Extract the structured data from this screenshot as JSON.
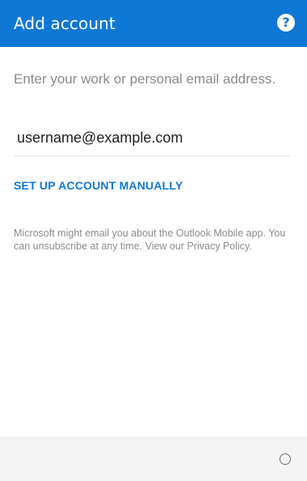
{
  "header": {
    "title": "Add account",
    "help_glyph": "?",
    "help_icon": "help-question-icon"
  },
  "form": {
    "prompt": "Enter your work or personal email address.",
    "email_value": "username@example.com"
  },
  "manual_setup": {
    "label": "SET UP ACCOUNT MANUALLY"
  },
  "disclaimer": {
    "text": "Microsoft might email you about the Outlook Mobile app. You can unsubscribe at any time. View our Privacy Policy."
  },
  "footer": {
    "spinner_icon": "loading-spinner-icon"
  },
  "colors": {
    "brand": "#0f78d4",
    "muted_text": "#8a8a8a",
    "footer_bg": "#f4f4f4"
  }
}
